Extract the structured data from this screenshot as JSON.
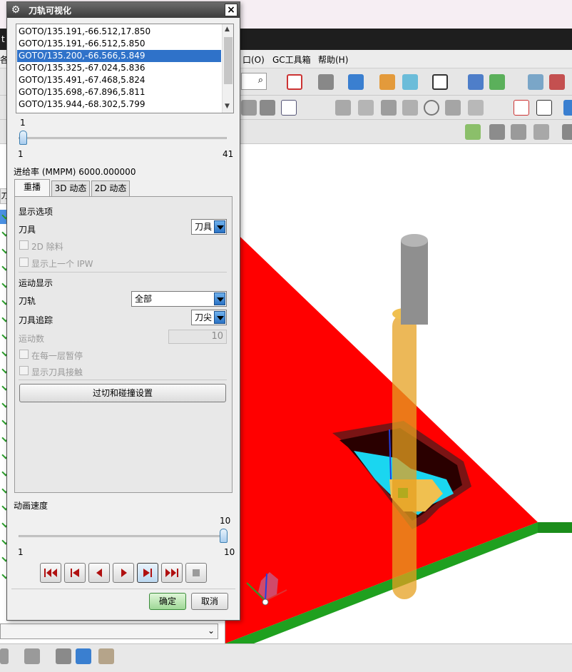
{
  "app": {
    "menu": [
      "口(O)",
      "GC工具箱",
      "帮助(H)"
    ],
    "left_menu_fragment": "各",
    "left_title_fragment": "t",
    "left_tree_letter": "刀"
  },
  "dialog": {
    "title": "刀轨可视化",
    "close_glyph": "×",
    "gear_glyph": "⚙",
    "list": {
      "items": [
        "GOTO/135.191,-66.512,17.850",
        "GOTO/135.191,-66.512,5.850",
        "GOTO/135.200,-66.566,5.849",
        "GOTO/135.325,-67.024,5.836",
        "GOTO/135.491,-67.468,5.824",
        "GOTO/135.698,-67.896,5.811",
        "GOTO/135.944,-68.302,5.799"
      ],
      "selected_index": 2
    },
    "position_slider": {
      "value": "1",
      "min": "1",
      "max": "41"
    },
    "feed_rate": "进给率 (MMPM) 6000.000000",
    "tabs": [
      "重播",
      "3D 动态",
      "2D 动态"
    ],
    "active_tab": 0,
    "display_options": {
      "heading": "显示选项",
      "tool_label": "刀具",
      "tool_value": "刀具",
      "check_2d_remove": "2D 除料",
      "check_show_prev_ipw": "显示上一个 IPW"
    },
    "motion_display": {
      "heading": "运动显示",
      "path_label": "刀轨",
      "path_value": "全部",
      "trace_label": "刀具追踪",
      "trace_value": "刀尖",
      "motion_count_label": "运动数",
      "motion_count_value": "10",
      "check_pause_layer": "在每一层暂停",
      "check_show_contact": "显示刀具接触"
    },
    "gouge_button": "过切和碰撞设置",
    "anim_speed": {
      "label": "动画速度",
      "value": "10",
      "min": "1",
      "max": "10"
    },
    "ok_label": "确定",
    "cancel_label": "取消"
  },
  "colors": {
    "plate": "#ff0000",
    "plate_edge": "#1fa01f",
    "selection": "#2f72c9",
    "tool_holder": "#8f8f8f",
    "tool": "#e6a020"
  }
}
